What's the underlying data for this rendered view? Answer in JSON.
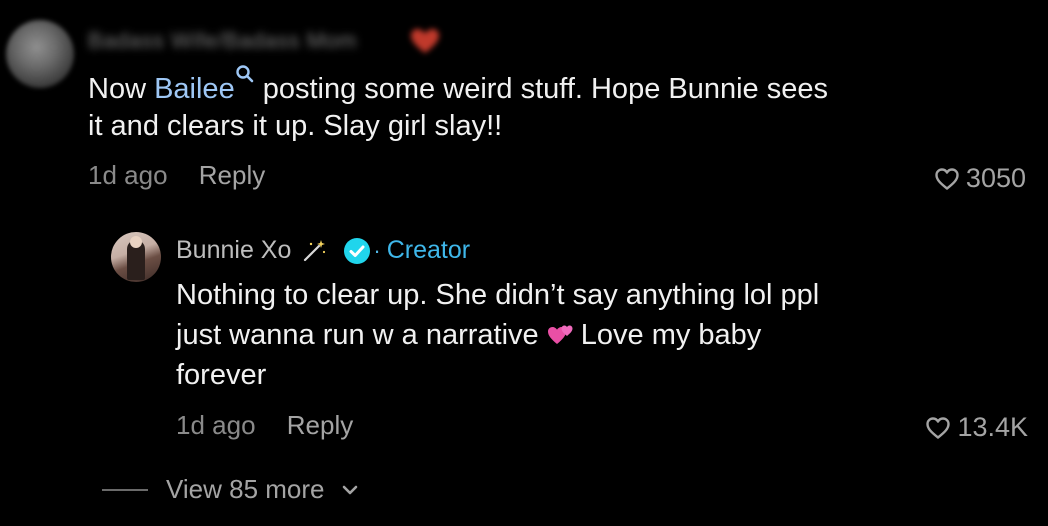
{
  "comment1": {
    "author_name": "Badass Wife/Badass Mom",
    "author_emoji": "heart-emoji",
    "text_line1_prefix": "Now ",
    "mention": "Bailee",
    "mention_icon": "search-icon",
    "text_line1_suffix": "posting some weird stuff. Hope Bunnie sees",
    "text_line2": "it and clears it up. Slay girl slay!!",
    "time": "1d ago",
    "reply_label": "Reply",
    "likes": "3050"
  },
  "reply1": {
    "author_name": "Bunnie Xo",
    "author_emoji": "magic-wand-emoji",
    "verified_icon": "verified-icon",
    "badge_dot": "·",
    "badge": "Creator",
    "text_line1": "Nothing to clear up. She didn’t say anything lol ppl",
    "text_line2_prefix": "just wanna run w a narrative ",
    "text_emoji": "two-hearts-emoji",
    "text_line2_suffix": "Love my baby",
    "text_line3": "forever",
    "time": "1d ago",
    "reply_label": "Reply",
    "likes": "13.4K"
  },
  "view_more": {
    "label": "View 85 more",
    "icon": "chevron-down-icon"
  },
  "colors": {
    "background": "#000000",
    "text": "#f1f1f1",
    "muted": "#8a8a8a",
    "mention": "#9ec7f5",
    "creator": "#3fb7ea"
  }
}
